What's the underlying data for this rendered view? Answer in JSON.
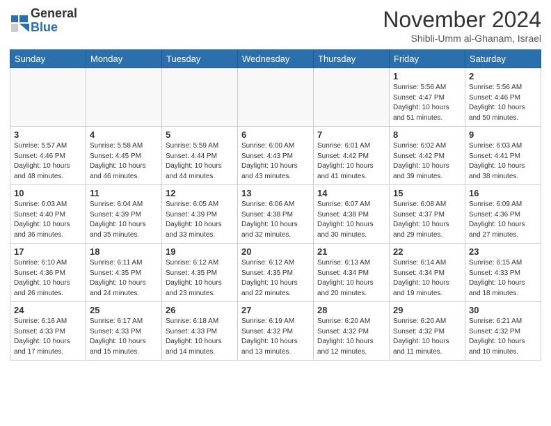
{
  "header": {
    "logo_general": "General",
    "logo_blue": "Blue",
    "month_title": "November 2024",
    "subtitle": "Shibli-Umm al-Ghanam, Israel"
  },
  "days": [
    "Sunday",
    "Monday",
    "Tuesday",
    "Wednesday",
    "Thursday",
    "Friday",
    "Saturday"
  ],
  "weeks": [
    [
      {
        "day": "",
        "info": ""
      },
      {
        "day": "",
        "info": ""
      },
      {
        "day": "",
        "info": ""
      },
      {
        "day": "",
        "info": ""
      },
      {
        "day": "",
        "info": ""
      },
      {
        "day": "1",
        "info": "Sunrise: 5:56 AM\nSunset: 4:47 PM\nDaylight: 10 hours\nand 51 minutes."
      },
      {
        "day": "2",
        "info": "Sunrise: 5:56 AM\nSunset: 4:46 PM\nDaylight: 10 hours\nand 50 minutes."
      }
    ],
    [
      {
        "day": "3",
        "info": "Sunrise: 5:57 AM\nSunset: 4:46 PM\nDaylight: 10 hours\nand 48 minutes."
      },
      {
        "day": "4",
        "info": "Sunrise: 5:58 AM\nSunset: 4:45 PM\nDaylight: 10 hours\nand 46 minutes."
      },
      {
        "day": "5",
        "info": "Sunrise: 5:59 AM\nSunset: 4:44 PM\nDaylight: 10 hours\nand 44 minutes."
      },
      {
        "day": "6",
        "info": "Sunrise: 6:00 AM\nSunset: 4:43 PM\nDaylight: 10 hours\nand 43 minutes."
      },
      {
        "day": "7",
        "info": "Sunrise: 6:01 AM\nSunset: 4:42 PM\nDaylight: 10 hours\nand 41 minutes."
      },
      {
        "day": "8",
        "info": "Sunrise: 6:02 AM\nSunset: 4:42 PM\nDaylight: 10 hours\nand 39 minutes."
      },
      {
        "day": "9",
        "info": "Sunrise: 6:03 AM\nSunset: 4:41 PM\nDaylight: 10 hours\nand 38 minutes."
      }
    ],
    [
      {
        "day": "10",
        "info": "Sunrise: 6:03 AM\nSunset: 4:40 PM\nDaylight: 10 hours\nand 36 minutes."
      },
      {
        "day": "11",
        "info": "Sunrise: 6:04 AM\nSunset: 4:39 PM\nDaylight: 10 hours\nand 35 minutes."
      },
      {
        "day": "12",
        "info": "Sunrise: 6:05 AM\nSunset: 4:39 PM\nDaylight: 10 hours\nand 33 minutes."
      },
      {
        "day": "13",
        "info": "Sunrise: 6:06 AM\nSunset: 4:38 PM\nDaylight: 10 hours\nand 32 minutes."
      },
      {
        "day": "14",
        "info": "Sunrise: 6:07 AM\nSunset: 4:38 PM\nDaylight: 10 hours\nand 30 minutes."
      },
      {
        "day": "15",
        "info": "Sunrise: 6:08 AM\nSunset: 4:37 PM\nDaylight: 10 hours\nand 29 minutes."
      },
      {
        "day": "16",
        "info": "Sunrise: 6:09 AM\nSunset: 4:36 PM\nDaylight: 10 hours\nand 27 minutes."
      }
    ],
    [
      {
        "day": "17",
        "info": "Sunrise: 6:10 AM\nSunset: 4:36 PM\nDaylight: 10 hours\nand 26 minutes."
      },
      {
        "day": "18",
        "info": "Sunrise: 6:11 AM\nSunset: 4:35 PM\nDaylight: 10 hours\nand 24 minutes."
      },
      {
        "day": "19",
        "info": "Sunrise: 6:12 AM\nSunset: 4:35 PM\nDaylight: 10 hours\nand 23 minutes."
      },
      {
        "day": "20",
        "info": "Sunrise: 6:12 AM\nSunset: 4:35 PM\nDaylight: 10 hours\nand 22 minutes."
      },
      {
        "day": "21",
        "info": "Sunrise: 6:13 AM\nSunset: 4:34 PM\nDaylight: 10 hours\nand 20 minutes."
      },
      {
        "day": "22",
        "info": "Sunrise: 6:14 AM\nSunset: 4:34 PM\nDaylight: 10 hours\nand 19 minutes."
      },
      {
        "day": "23",
        "info": "Sunrise: 6:15 AM\nSunset: 4:33 PM\nDaylight: 10 hours\nand 18 minutes."
      }
    ],
    [
      {
        "day": "24",
        "info": "Sunrise: 6:16 AM\nSunset: 4:33 PM\nDaylight: 10 hours\nand 17 minutes."
      },
      {
        "day": "25",
        "info": "Sunrise: 6:17 AM\nSunset: 4:33 PM\nDaylight: 10 hours\nand 15 minutes."
      },
      {
        "day": "26",
        "info": "Sunrise: 6:18 AM\nSunset: 4:33 PM\nDaylight: 10 hours\nand 14 minutes."
      },
      {
        "day": "27",
        "info": "Sunrise: 6:19 AM\nSunset: 4:32 PM\nDaylight: 10 hours\nand 13 minutes."
      },
      {
        "day": "28",
        "info": "Sunrise: 6:20 AM\nSunset: 4:32 PM\nDaylight: 10 hours\nand 12 minutes."
      },
      {
        "day": "29",
        "info": "Sunrise: 6:20 AM\nSunset: 4:32 PM\nDaylight: 10 hours\nand 11 minutes."
      },
      {
        "day": "30",
        "info": "Sunrise: 6:21 AM\nSunset: 4:32 PM\nDaylight: 10 hours\nand 10 minutes."
      }
    ]
  ]
}
